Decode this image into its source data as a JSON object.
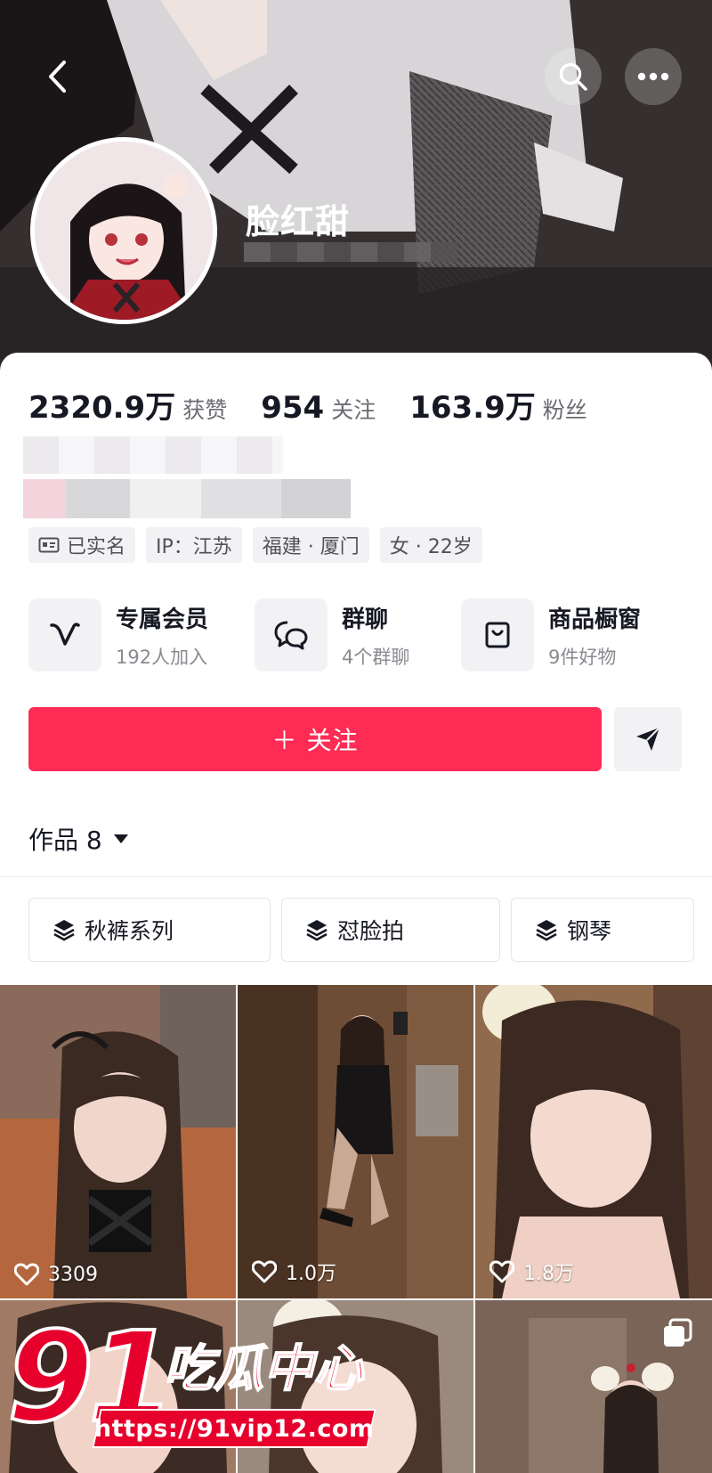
{
  "profile": {
    "nickname": "脸红甜"
  },
  "stats": [
    {
      "value": "2320.9万",
      "label": "获赞"
    },
    {
      "value": "954",
      "label": "关注"
    },
    {
      "value": "163.9万",
      "label": "粉丝"
    }
  ],
  "tags": [
    {
      "icon": "id-card-icon",
      "text": "已实名"
    },
    {
      "icon": "",
      "text": "IP：江苏"
    },
    {
      "icon": "",
      "text": "福建 · 厦门"
    },
    {
      "icon": "",
      "text": "女 · 22岁"
    }
  ],
  "features": [
    {
      "icon": "vip-v-icon",
      "title": "专属会员",
      "sub": "192人加入"
    },
    {
      "icon": "group-chat-icon",
      "title": "群聊",
      "sub": "4个群聊"
    },
    {
      "icon": "shop-bag-icon",
      "title": "商品橱窗",
      "sub": "9件好物"
    }
  ],
  "actions": {
    "follow_label": "＋ 关注"
  },
  "works_tab": {
    "label": "作品 8"
  },
  "collections": [
    {
      "icon": "layers-icon",
      "label": "秋裤系列"
    },
    {
      "icon": "layers-icon",
      "label": "怼脸拍"
    },
    {
      "icon": "layers-icon",
      "label": "钢琴"
    }
  ],
  "videos": [
    {
      "likes": "3309"
    },
    {
      "likes": "1.0万"
    },
    {
      "likes": "1.8万"
    }
  ],
  "watermark": {
    "number": "91",
    "name": "吃瓜中心",
    "url": "https://91vip12.com"
  },
  "colors": {
    "accent": "#fe2c55",
    "watermark_red": "#e8002d"
  }
}
